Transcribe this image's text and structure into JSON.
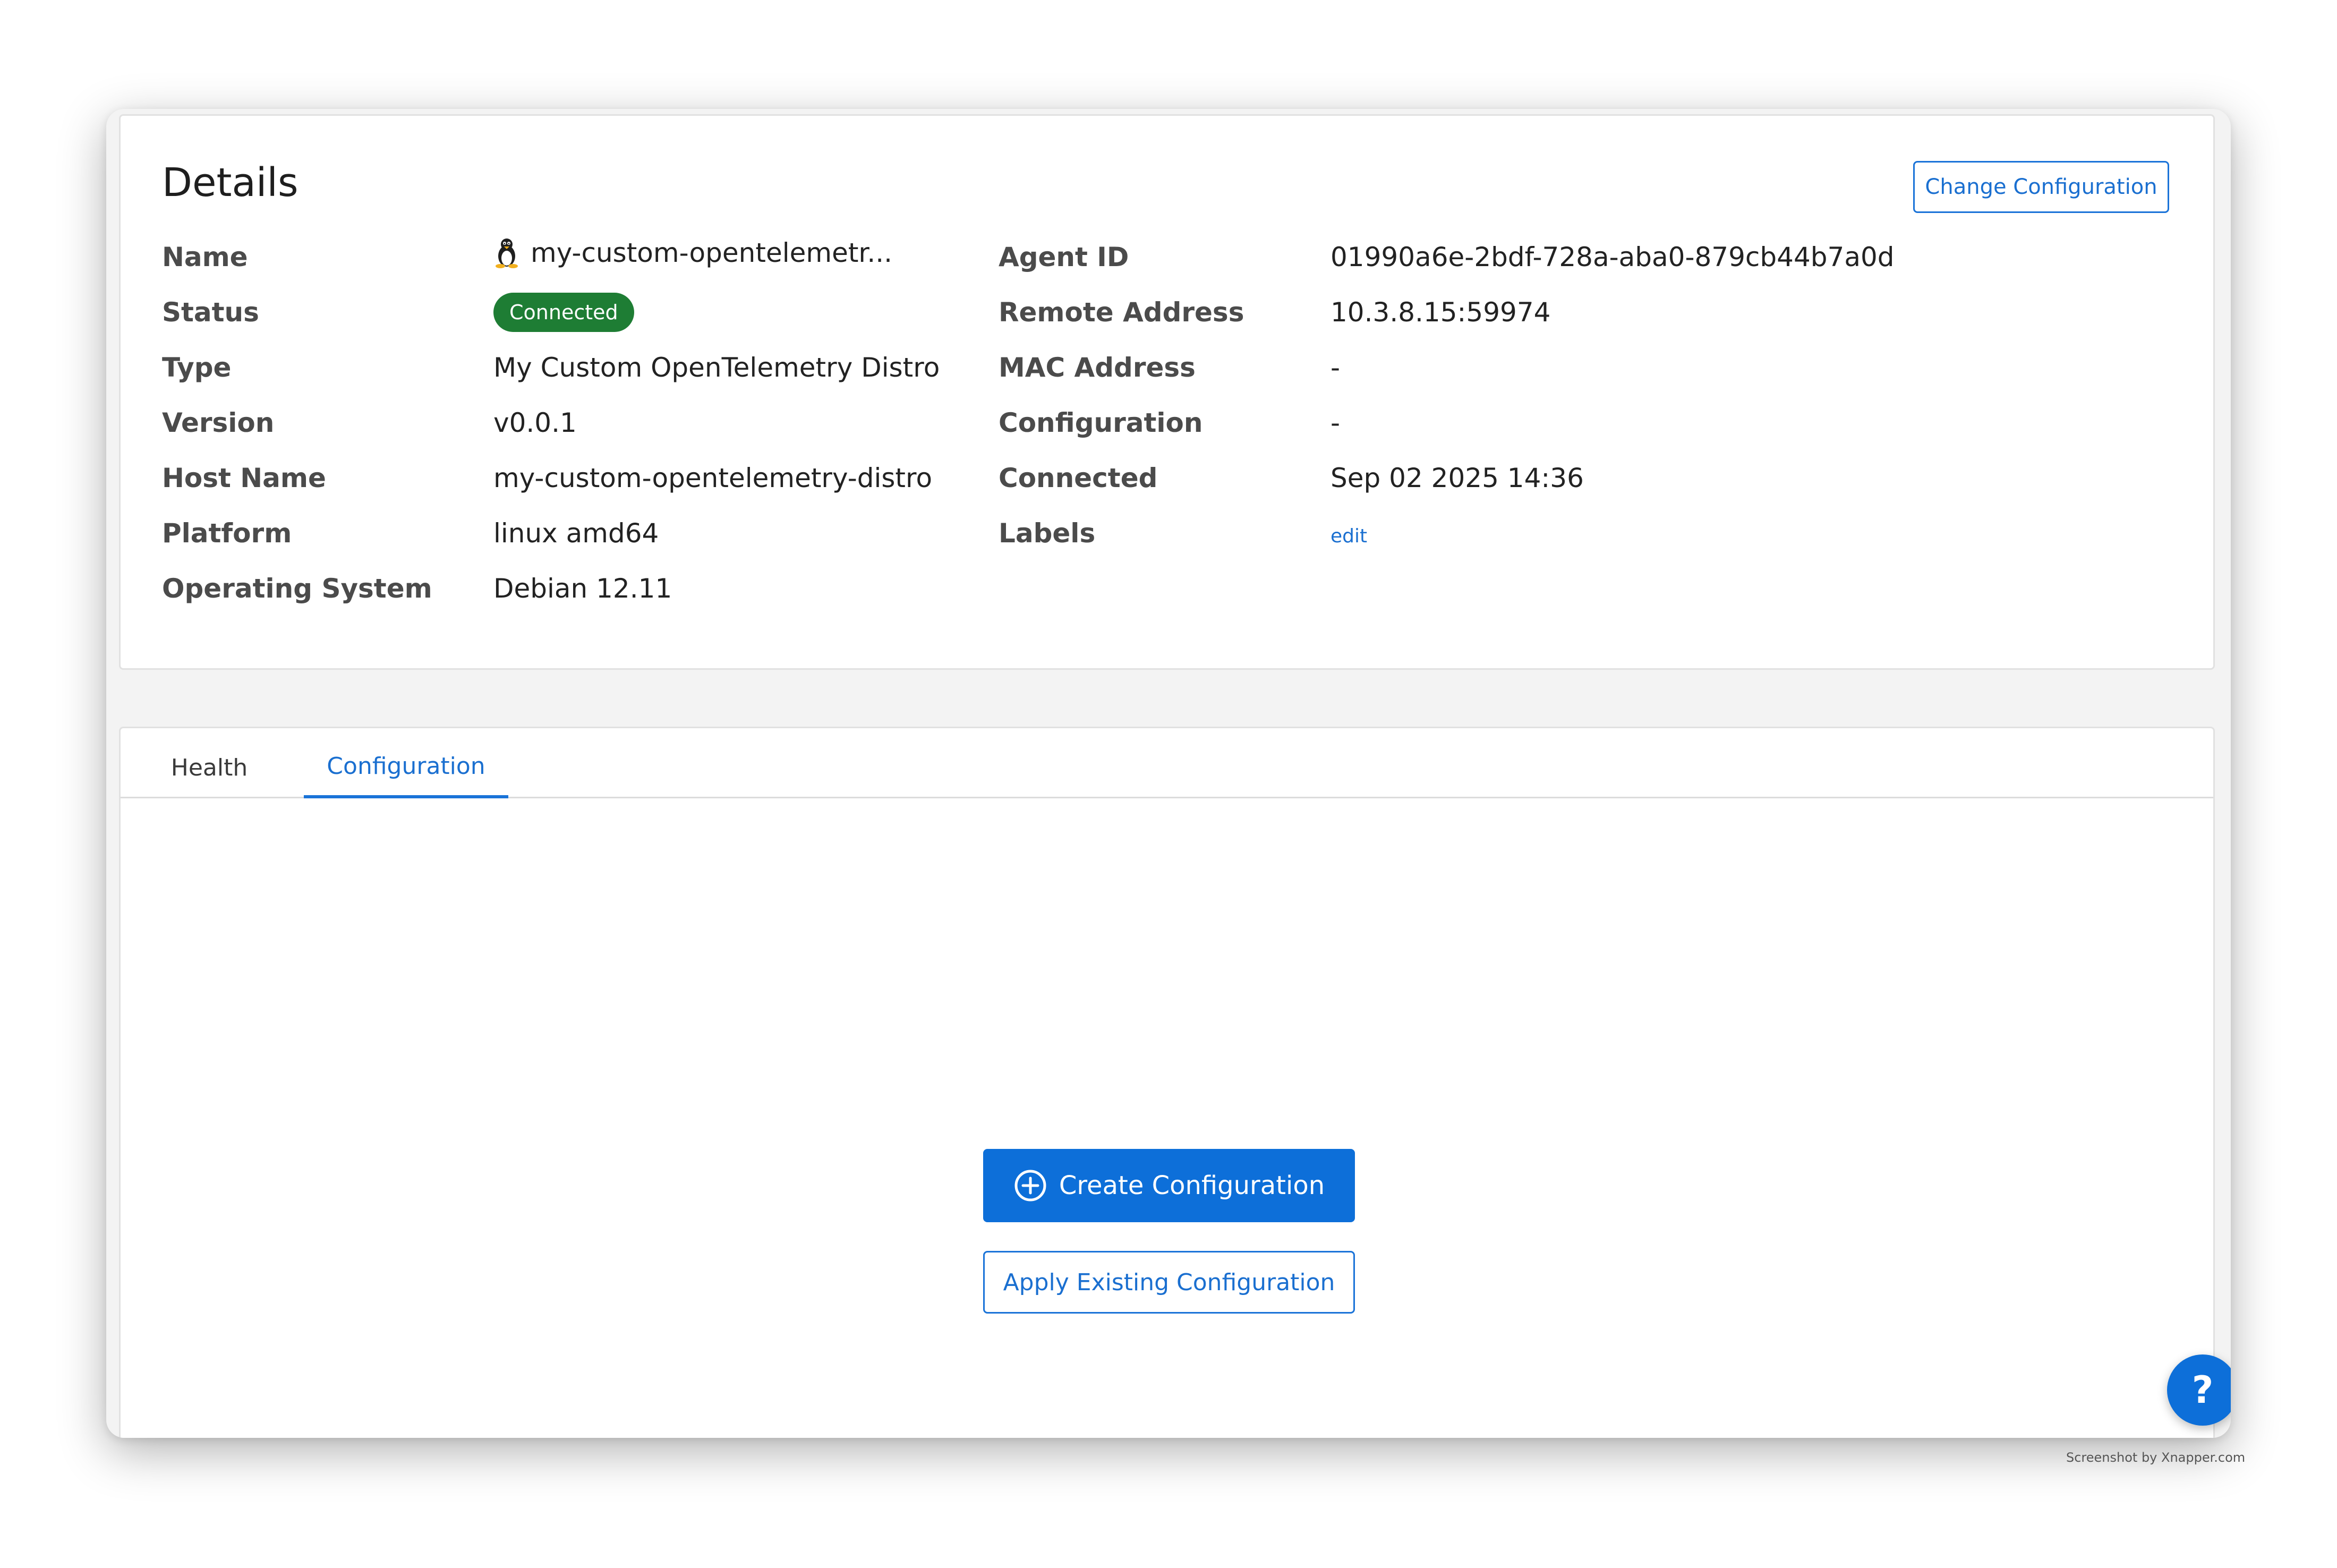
{
  "details": {
    "title": "Details",
    "change_button_label": "Change Configuration",
    "fields": {
      "name": {
        "label": "Name",
        "value": "my-custom-opentelemetr...",
        "icon": "linux-tux-icon"
      },
      "status": {
        "label": "Status",
        "value": "Connected",
        "color": "#1e7d34"
      },
      "type": {
        "label": "Type",
        "value": "My Custom OpenTelemetry Distro"
      },
      "version": {
        "label": "Version",
        "value": "v0.0.1"
      },
      "host_name": {
        "label": "Host Name",
        "value": "my-custom-opentelemetry-distro"
      },
      "platform": {
        "label": "Platform",
        "value": "linux amd64"
      },
      "operating_system": {
        "label": "Operating System",
        "value": "Debian 12.11"
      },
      "agent_id": {
        "label": "Agent ID",
        "value": "01990a6e-2bdf-728a-aba0-879cb44b7a0d"
      },
      "remote_address": {
        "label": "Remote Address",
        "value": "10.3.8.15:59974"
      },
      "mac_address": {
        "label": "MAC Address",
        "value": "-"
      },
      "configuration": {
        "label": "Configuration",
        "value": "-"
      },
      "connected": {
        "label": "Connected",
        "value": "Sep 02 2025 14:36"
      },
      "labels": {
        "label": "Labels",
        "edit_link": "edit"
      }
    }
  },
  "tabs": [
    {
      "label": "Health",
      "active": false
    },
    {
      "label": "Configuration",
      "active": true
    }
  ],
  "configuration_panel": {
    "create_button_label": "Create Configuration",
    "create_button_icon": "plus-circle-icon",
    "apply_button_label": "Apply Existing Configuration"
  },
  "help_button": {
    "label": "?",
    "icon": "help-icon"
  },
  "watermark": "Screenshot by Xnapper.com",
  "colors": {
    "accent": "#1a73d8",
    "primary_button": "#0d6fd9",
    "status_connected": "#1e7d34",
    "background": "#f3f3f3"
  }
}
